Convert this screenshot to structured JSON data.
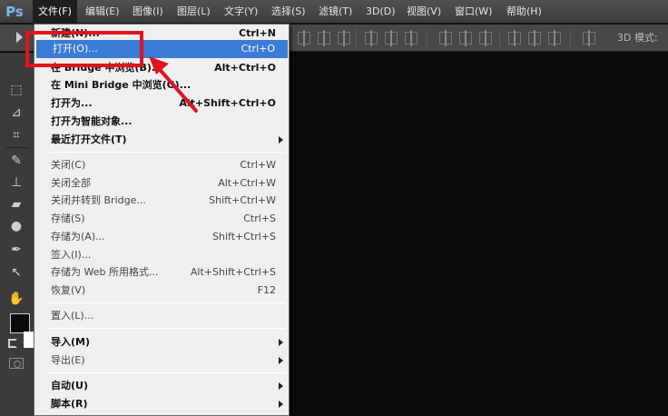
{
  "app": {
    "logo": "Ps"
  },
  "menubar": {
    "items": [
      {
        "label": "文件(F)"
      },
      {
        "label": "编辑(E)"
      },
      {
        "label": "图像(I)"
      },
      {
        "label": "图层(L)"
      },
      {
        "label": "文字(Y)"
      },
      {
        "label": "选择(S)"
      },
      {
        "label": "滤镜(T)"
      },
      {
        "label": "3D(D)"
      },
      {
        "label": "视图(V)"
      },
      {
        "label": "窗口(W)"
      },
      {
        "label": "帮助(H)"
      }
    ],
    "active_item": "文件(F)"
  },
  "optionsbar": {
    "mode_3d_label": "3D 模式:"
  },
  "file_menu": {
    "items": [
      {
        "label": "新建(N)...",
        "shortcut": "Ctrl+N",
        "bold": true
      },
      {
        "label": "打开(O)...",
        "shortcut": "Ctrl+O",
        "bold": true,
        "highlighted": true
      },
      {
        "label": "在 Bridge 中浏览(B)...",
        "shortcut": "Alt+Ctrl+O",
        "bold": true
      },
      {
        "label": "在 Mini Bridge 中浏览(G)...",
        "shortcut": "",
        "bold": true
      },
      {
        "label": "打开为...",
        "shortcut": "Alt+Shift+Ctrl+O",
        "bold": true
      },
      {
        "label": "打开为智能对象...",
        "shortcut": "",
        "bold": true
      },
      {
        "label": "最近打开文件(T)",
        "shortcut": "",
        "bold": true,
        "submenu": true
      },
      {
        "label": "关闭(C)",
        "shortcut": "Ctrl+W"
      },
      {
        "label": "关闭全部",
        "shortcut": "Alt+Ctrl+W"
      },
      {
        "label": "关闭并转到 Bridge...",
        "shortcut": "Shift+Ctrl+W"
      },
      {
        "label": "存储(S)",
        "shortcut": "Ctrl+S"
      },
      {
        "label": "存储为(A)...",
        "shortcut": "Shift+Ctrl+S"
      },
      {
        "label": "签入(I)...",
        "shortcut": ""
      },
      {
        "label": "存储为 Web 所用格式...",
        "shortcut": "Alt+Shift+Ctrl+S"
      },
      {
        "label": "恢复(V)",
        "shortcut": "F12"
      },
      {
        "label": "置入(L)...",
        "shortcut": ""
      },
      {
        "label": "导入(M)",
        "shortcut": "",
        "bold": true,
        "submenu": true
      },
      {
        "label": "导出(E)",
        "shortcut": "",
        "submenu": true
      },
      {
        "label": "自动(U)",
        "shortcut": "",
        "bold": true,
        "submenu": true
      },
      {
        "label": "脚本(R)",
        "shortcut": "",
        "bold": true,
        "submenu": true
      }
    ]
  },
  "colors": {
    "highlight_bg": "#3a7bd5",
    "annotation_red": "#e0141e",
    "logo_blue": "#7fb6ee"
  },
  "icons": {
    "tools": [
      "marquee-icon",
      "lasso-icon",
      "crop-icon",
      "healing-brush-icon",
      "stamp-icon",
      "eraser-icon",
      "blur-icon",
      "pen-icon",
      "path-select-icon",
      "hand-icon"
    ]
  }
}
